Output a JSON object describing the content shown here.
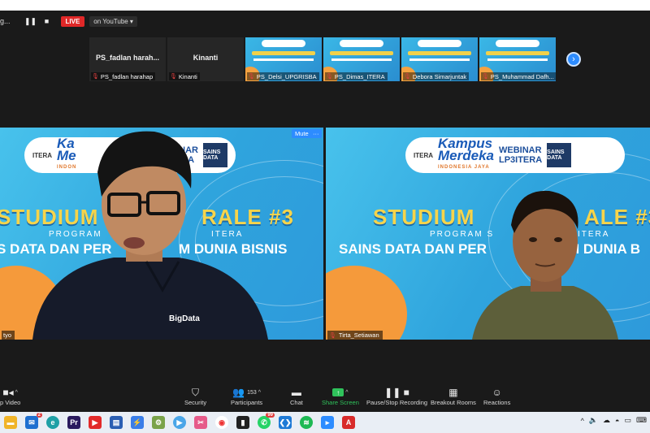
{
  "top_bar": {
    "recording_text": "g...",
    "pause_icon": "pause-icon",
    "stop_icon": "stop-icon",
    "live_badge": "LIVE",
    "live_destination": "on YouTube ▾"
  },
  "thumbnails": [
    {
      "center_name": "PS_fadlan  harah...",
      "label": "PS_fadlan harahap",
      "has_video": false
    },
    {
      "center_name": "Kinanti",
      "label": "Kinanti",
      "has_video": false
    },
    {
      "center_name": "",
      "label": "PS_Delsi_UPGRISBA",
      "has_video": true
    },
    {
      "center_name": "",
      "label": "PS_Dimas_ITERA",
      "has_video": true
    },
    {
      "center_name": "",
      "label": "Debora Simarjuntak",
      "has_video": true
    },
    {
      "center_name": "",
      "label": "PS_Muhammad Dafh...",
      "has_video": true
    }
  ],
  "next_page_icon": "chevron-right-icon",
  "left_tile": {
    "name": "tyo",
    "mute_label": "Mute",
    "more_label": "···",
    "slide": {
      "itera": "ITERA",
      "kampus": "Ka",
      "merdeka": "Me",
      "sub": "INDON",
      "webinar": "BINAR",
      "webinar2": "TERA",
      "sd": "SAINS DATA",
      "title_a": "STUDIUM",
      "title_b": "RALE #3",
      "program": "PROGRAM",
      "program_b": "ITERA",
      "sains_a": "S DATA DAN PER",
      "sains_b": "M DUNIA BISNIS"
    },
    "shirt_logo": "BigData"
  },
  "right_tile": {
    "name": "Tirta_Setiawan",
    "slide": {
      "itera": "ITERA",
      "kampus": "Kampus",
      "merdeka": "Merdeka",
      "sub": "INDONESIA JAYA",
      "webinar": "WEBINAR",
      "webinar2": "LP3ITERA",
      "sd": "SAINS DATA",
      "title_a": "STUDIUM",
      "title_b": "ALE #3",
      "program": "PROGRAM S",
      "program_b": "ITERA",
      "sains_a": "SAINS DATA DAN PER",
      "sains_b": "M DUNIA B"
    }
  },
  "toolbar": {
    "video": {
      "label": "p Video",
      "icon": "video-camera-icon"
    },
    "security": {
      "label": "Security",
      "icon": "shield-icon"
    },
    "participants": {
      "label": "Participants",
      "icon": "participants-icon",
      "count": "153"
    },
    "chat": {
      "label": "Chat",
      "icon": "chat-icon"
    },
    "share": {
      "label": "Share Screen",
      "icon": "share-screen-icon"
    },
    "recording": {
      "label": "Pause/Stop Recording",
      "icon": "pause-stop-recording-icon"
    },
    "breakout": {
      "label": "Breakout Rooms",
      "icon": "breakout-rooms-icon"
    },
    "reactions": {
      "label": "Reactions",
      "icon": "reactions-icon"
    }
  },
  "taskbar": {
    "mail_badge": "2",
    "whatsapp_badge": "99"
  },
  "colors": {
    "zoom_blue": "#2d8cff",
    "share_green": "#2fc25b",
    "live_red": "#e02828",
    "slide_blue": "#3ab7e6",
    "title_yellow": "#f6d44b"
  }
}
